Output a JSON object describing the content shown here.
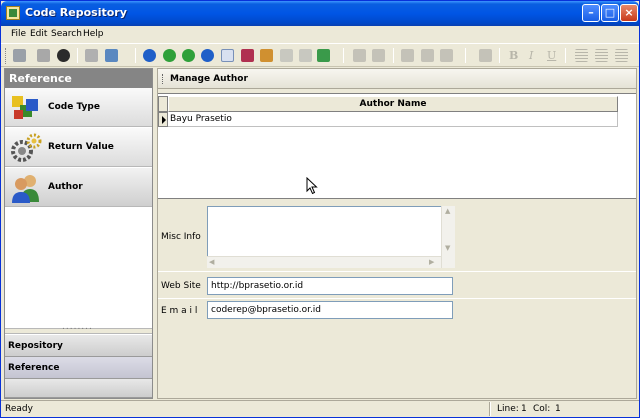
{
  "window": {
    "title": "Code Repository"
  },
  "menu": [
    "File",
    "Edit",
    "Search",
    "Help"
  ],
  "toolbar": {
    "icons": [
      "new-icon",
      "open-icon",
      "delete-icon",
      "print-icon",
      "print-preview-icon",
      "first-record-icon",
      "prev-record-icon",
      "next-record-icon",
      "last-record-icon",
      "new-record-icon",
      "edit-icon",
      "edit-record-icon",
      "post-icon",
      "cancel-icon",
      "refresh-icon",
      "undo-icon",
      "redo-icon",
      "cut-icon",
      "copy-icon",
      "paste-icon",
      "bookmark-icon",
      "bold-icon",
      "italic-icon",
      "underline-icon",
      "align-left-icon",
      "align-center-icon",
      "align-right-icon"
    ],
    "format_glyphs": {
      "bold": "B",
      "italic": "I",
      "underline": "U"
    }
  },
  "left_panel": {
    "header": "Reference",
    "nav": [
      {
        "label": "Code Type",
        "icon": "cubes-icon"
      },
      {
        "label": "Return Value",
        "icon": "gears-icon"
      },
      {
        "label": "Author",
        "icon": "users-icon"
      }
    ],
    "sections": [
      {
        "label": "Repository"
      },
      {
        "label": "Reference"
      }
    ],
    "active_nav": "Author",
    "selected_section": "Reference"
  },
  "right_panel": {
    "header": "Manage Author",
    "grid": {
      "columns": [
        "Author Name"
      ],
      "rows": [
        [
          "Bayu Prasetio"
        ]
      ]
    },
    "fields": {
      "misc_info": {
        "label": "Misc Info",
        "value": ""
      },
      "web_site": {
        "label": "Web Site",
        "value": "http://bprasetio.or.id"
      },
      "email": {
        "label": "E m a i l",
        "value": "coderep@bprasetio.or.id"
      }
    }
  },
  "status": {
    "text": "Ready",
    "line_label": "Line:",
    "line": "1",
    "col_label": "Col:",
    "col": "1"
  },
  "colors": {
    "titlebar": "#0055e5",
    "face": "#ece9d8",
    "panel_header": "#858585"
  }
}
